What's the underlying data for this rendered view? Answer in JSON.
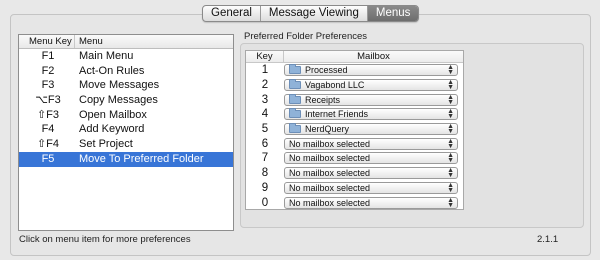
{
  "tabs": [
    {
      "label": "General",
      "active": false
    },
    {
      "label": "Message Viewing",
      "active": false
    },
    {
      "label": "Menus",
      "active": true
    }
  ],
  "menu_list": {
    "columns": [
      "Menu Key",
      "Menu"
    ],
    "rows": [
      {
        "key": "F1",
        "menu": "Main Menu"
      },
      {
        "key": "F2",
        "menu": "Act-On Rules"
      },
      {
        "key": "F3",
        "menu": "Move Messages"
      },
      {
        "key": "⌥F3",
        "menu": "Copy Messages"
      },
      {
        "key": "⇧F3",
        "menu": "Open Mailbox"
      },
      {
        "key": "F4",
        "menu": "Add Keyword"
      },
      {
        "key": "⇧F4",
        "menu": "Set Project"
      },
      {
        "key": "F5",
        "menu": "Move To Preferred Folder",
        "selected": true
      }
    ]
  },
  "preferred": {
    "title": "Preferred Folder Preferences",
    "columns": [
      "Key",
      "Mailbox"
    ],
    "rows": [
      {
        "key": "1",
        "mailbox": "Processed",
        "folder": true
      },
      {
        "key": "2",
        "mailbox": "Vagabond LLC",
        "folder": true
      },
      {
        "key": "3",
        "mailbox": "Receipts",
        "folder": true
      },
      {
        "key": "4",
        "mailbox": "Internet Friends",
        "folder": true
      },
      {
        "key": "5",
        "mailbox": "NerdQuery",
        "folder": true
      },
      {
        "key": "6",
        "mailbox": "No mailbox selected",
        "folder": false
      },
      {
        "key": "7",
        "mailbox": "No mailbox selected",
        "folder": false
      },
      {
        "key": "8",
        "mailbox": "No mailbox selected",
        "folder": false
      },
      {
        "key": "9",
        "mailbox": "No mailbox selected",
        "folder": false
      },
      {
        "key": "0",
        "mailbox": "No mailbox selected",
        "folder": false
      }
    ]
  },
  "footer": {
    "hint": "Click on menu item for more preferences",
    "version": "2.1.1"
  },
  "colors": {
    "selection": "#3875d7",
    "active_tab": "#7a7a7a"
  }
}
